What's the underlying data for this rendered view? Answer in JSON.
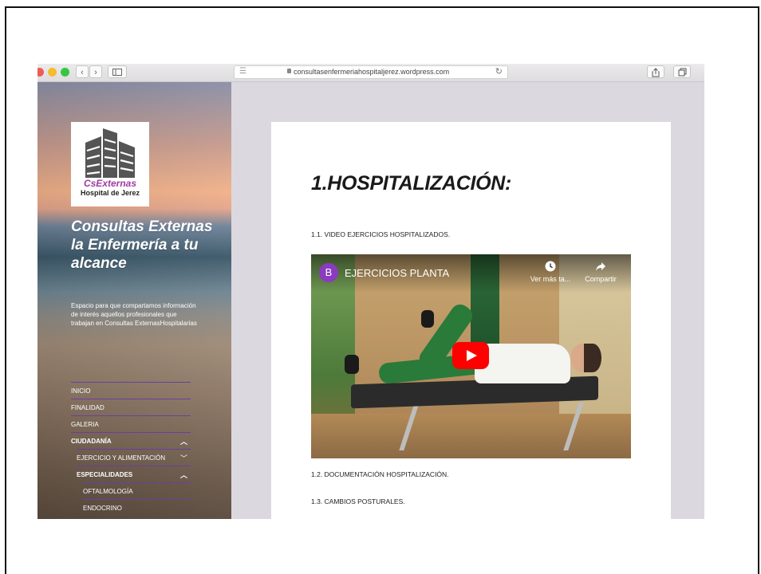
{
  "browser": {
    "url": "consultasenfermeriahospitaljerez.wordpress.com",
    "back_glyph": "‹",
    "forward_glyph": "›"
  },
  "sidebar": {
    "logo_text": "CsExternas",
    "logo_subtext": "Hospital de Jerez",
    "site_title": "Consultas Externas la Enfermería a tu alcance",
    "site_description": "Espacio para que compartamos información de interés aquellos profesionales que trabajan en Consultas ExternasHospitalarias",
    "menu": [
      {
        "label": "INICIO"
      },
      {
        "label": "FINALIDAD"
      },
      {
        "label": "GALERIA"
      },
      {
        "label": "CIUDADANÍA"
      },
      {
        "label": "EJERCICIO Y ALIMENTACIÓN"
      },
      {
        "label": "ESPECIALIDADES"
      },
      {
        "label": "OFTALMOLOGÍA"
      },
      {
        "label": "ENDOCRINO"
      }
    ]
  },
  "content": {
    "heading": "1.HOSPITALIZACIÓN:",
    "section1": "1.1. VIDEO EJERCICIOS HOSPITALIZADOS.",
    "video": {
      "channel_initial": "B",
      "title": "EJERCICIOS PLANTA",
      "watch_later": "Ver más ta...",
      "share": "Compartir"
    },
    "section2": "1.2. DOCUMENTACIÓN HOSPITALIZACIÓN.",
    "section3": "1.3. CAMBIOS POSTURALES."
  },
  "icons": {
    "sidebar_toggle": "sidebar-icon",
    "reader": "reader-icon",
    "lock": "lock-icon",
    "reload": "reload-icon",
    "share": "share-icon",
    "tabs": "tabs-icon",
    "clock": "clock-icon",
    "share_arrow": "share-arrow-icon",
    "play": "play-icon",
    "chevron": "chevron-icon"
  },
  "colors": {
    "menu_divider": "#6a3fa0",
    "youtube_red": "#ff0000",
    "logo_purple": "#a13aa0"
  }
}
